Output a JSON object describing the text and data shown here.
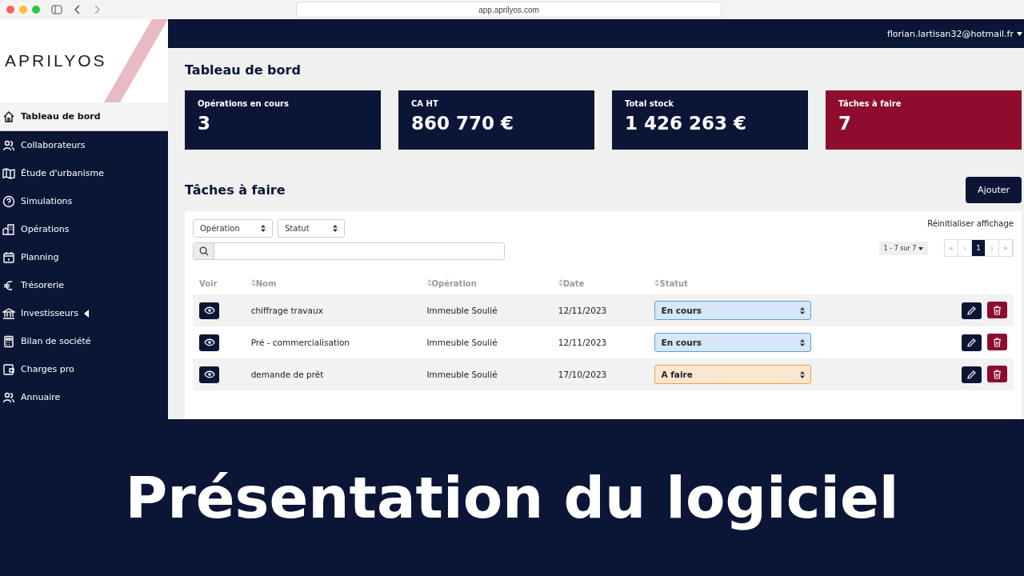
{
  "browser": {
    "url": "app.aprilyos.com"
  },
  "logo": "APRILYOS",
  "user": "florian.lartisan32@hotmail.fr",
  "sidebar": {
    "items": [
      {
        "label": "Tableau de bord",
        "selected": true
      },
      {
        "label": "Collaborateurs",
        "selected": false
      },
      {
        "label": "Étude d'urbanisme",
        "selected": false
      },
      {
        "label": "Simulations",
        "selected": false
      },
      {
        "label": "Opérations",
        "selected": false
      },
      {
        "label": "Planning",
        "selected": false
      },
      {
        "label": "Trésorerie",
        "selected": false
      },
      {
        "label": "Investisseurs",
        "selected": false,
        "submenu": true
      },
      {
        "label": "Bilan de société",
        "selected": false
      },
      {
        "label": "Charges pro",
        "selected": false
      },
      {
        "label": "Annuaire",
        "selected": false
      }
    ]
  },
  "page_title": "Tableau de bord",
  "stats": [
    {
      "label": "Opérations en cours",
      "value": "3",
      "kind": "normal"
    },
    {
      "label": "CA HT",
      "value": "860 770 €",
      "kind": "normal"
    },
    {
      "label": "Total stock",
      "value": "1 426 263 €",
      "kind": "normal"
    },
    {
      "label": "Tâches à faire",
      "value": "7",
      "kind": "alert"
    }
  ],
  "tasks": {
    "title": "Tâches à faire",
    "add_button": "Ajouter",
    "filters": [
      "Opération",
      "Statut"
    ],
    "reset": "Réinitialiser affichage",
    "page_size": "1 - 7 sur 7",
    "pagination": [
      {
        "label": "«",
        "selected": false
      },
      {
        "label": "‹",
        "selected": false
      },
      {
        "label": "1",
        "selected": true
      },
      {
        "label": "›",
        "selected": false
      },
      {
        "label": "»",
        "selected": false
      }
    ],
    "columns": [
      {
        "label": "Voir",
        "sortable": false
      },
      {
        "label": "Nom",
        "sortable": true
      },
      {
        "label": "Opération",
        "sortable": true
      },
      {
        "label": "Date",
        "sortable": true
      },
      {
        "label": "Statut",
        "sortable": true
      }
    ],
    "rows": [
      {
        "name": "chiffrage travaux",
        "operation": "Immeuble Soulié",
        "date": "12/11/2023",
        "status": "En cours",
        "kind": "in_progress"
      },
      {
        "name": "Pré - commercialisation",
        "operation": "Immeuble Soulié",
        "date": "12/11/2023",
        "status": "En cours",
        "kind": "in_progress"
      },
      {
        "name": "demande de prêt",
        "operation": "Immeuble Soulié",
        "date": "17/10/2023",
        "status": "A faire",
        "kind": "todo"
      }
    ]
  },
  "banner": "Présentation du logiciel"
}
